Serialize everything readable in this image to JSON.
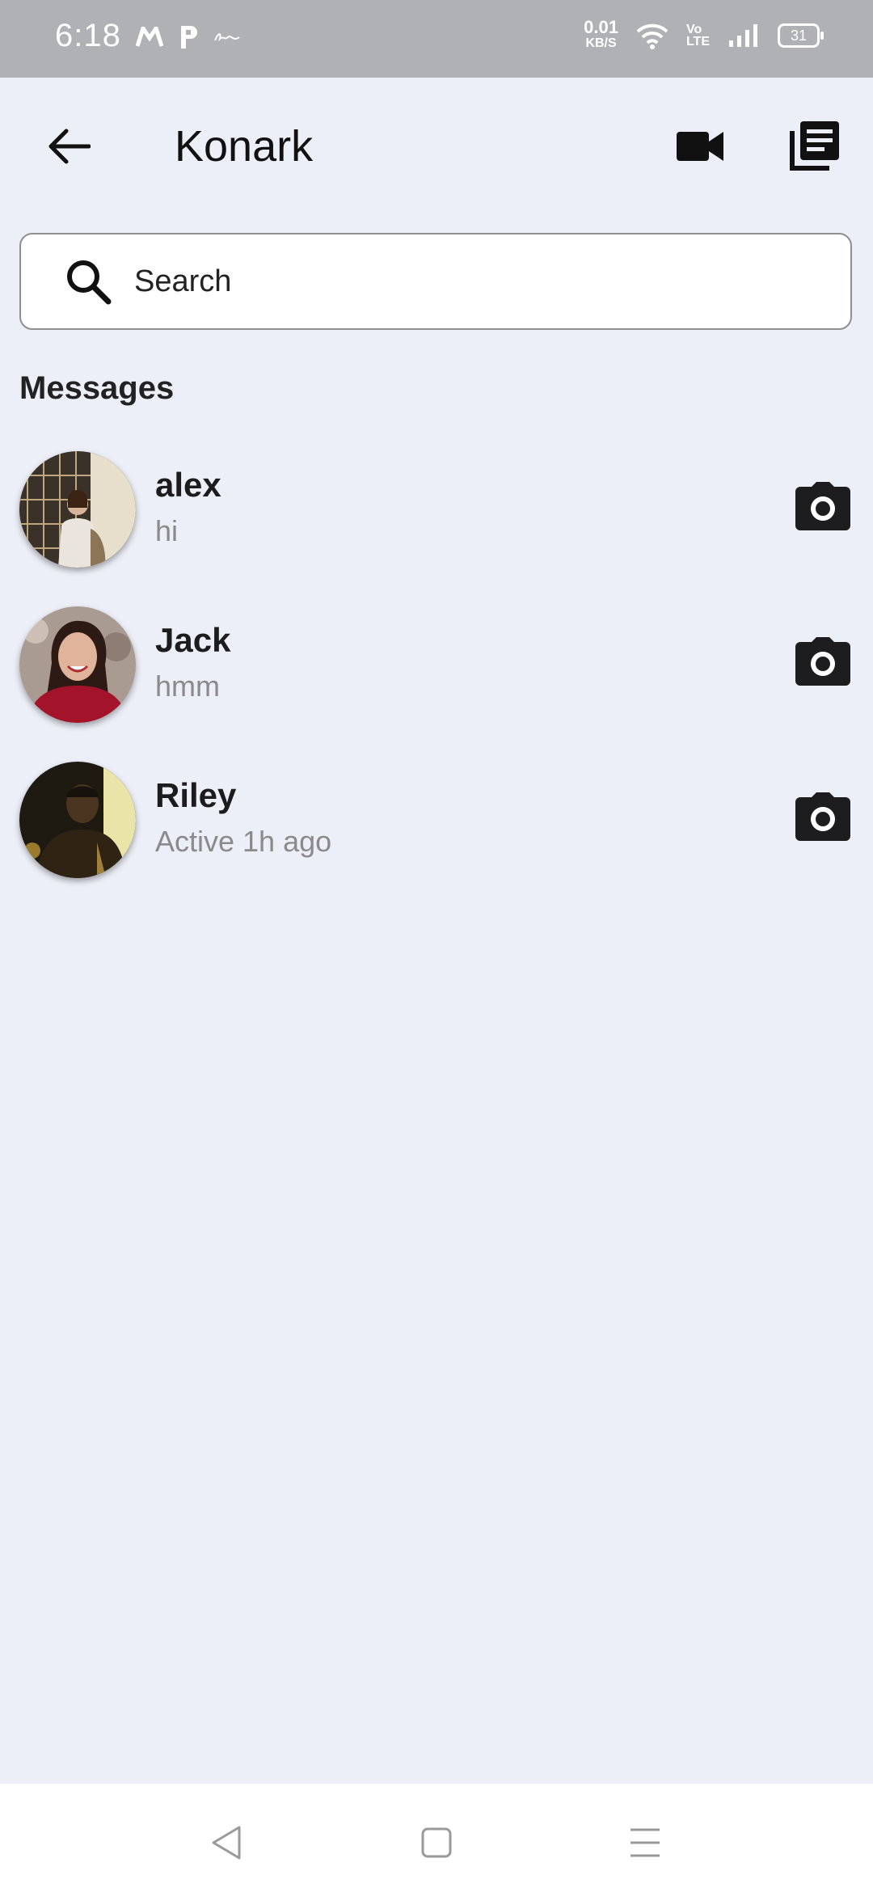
{
  "status_bar": {
    "time": "6:18",
    "net_speed_value": "0.01",
    "net_speed_unit": "KB/S",
    "volte_top": "Vo",
    "volte_bottom": "LTE",
    "battery": "31"
  },
  "header": {
    "title": "Konark"
  },
  "search": {
    "placeholder": "Search"
  },
  "section_title": "Messages",
  "messages": [
    {
      "name": "alex",
      "subtitle": "hi"
    },
    {
      "name": "Jack",
      "subtitle": "hmm"
    },
    {
      "name": "Riley",
      "subtitle": "Active 1h ago"
    }
  ],
  "icons": {
    "back": "arrow-left-icon",
    "video": "video-camera-icon",
    "library": "library-books-icon",
    "search": "search-icon",
    "camera": "camera-icon"
  },
  "colors": {
    "background": "#eceff7",
    "status_bar": "#b0b1b5",
    "subtitle_gray": "#8a8a8a"
  }
}
